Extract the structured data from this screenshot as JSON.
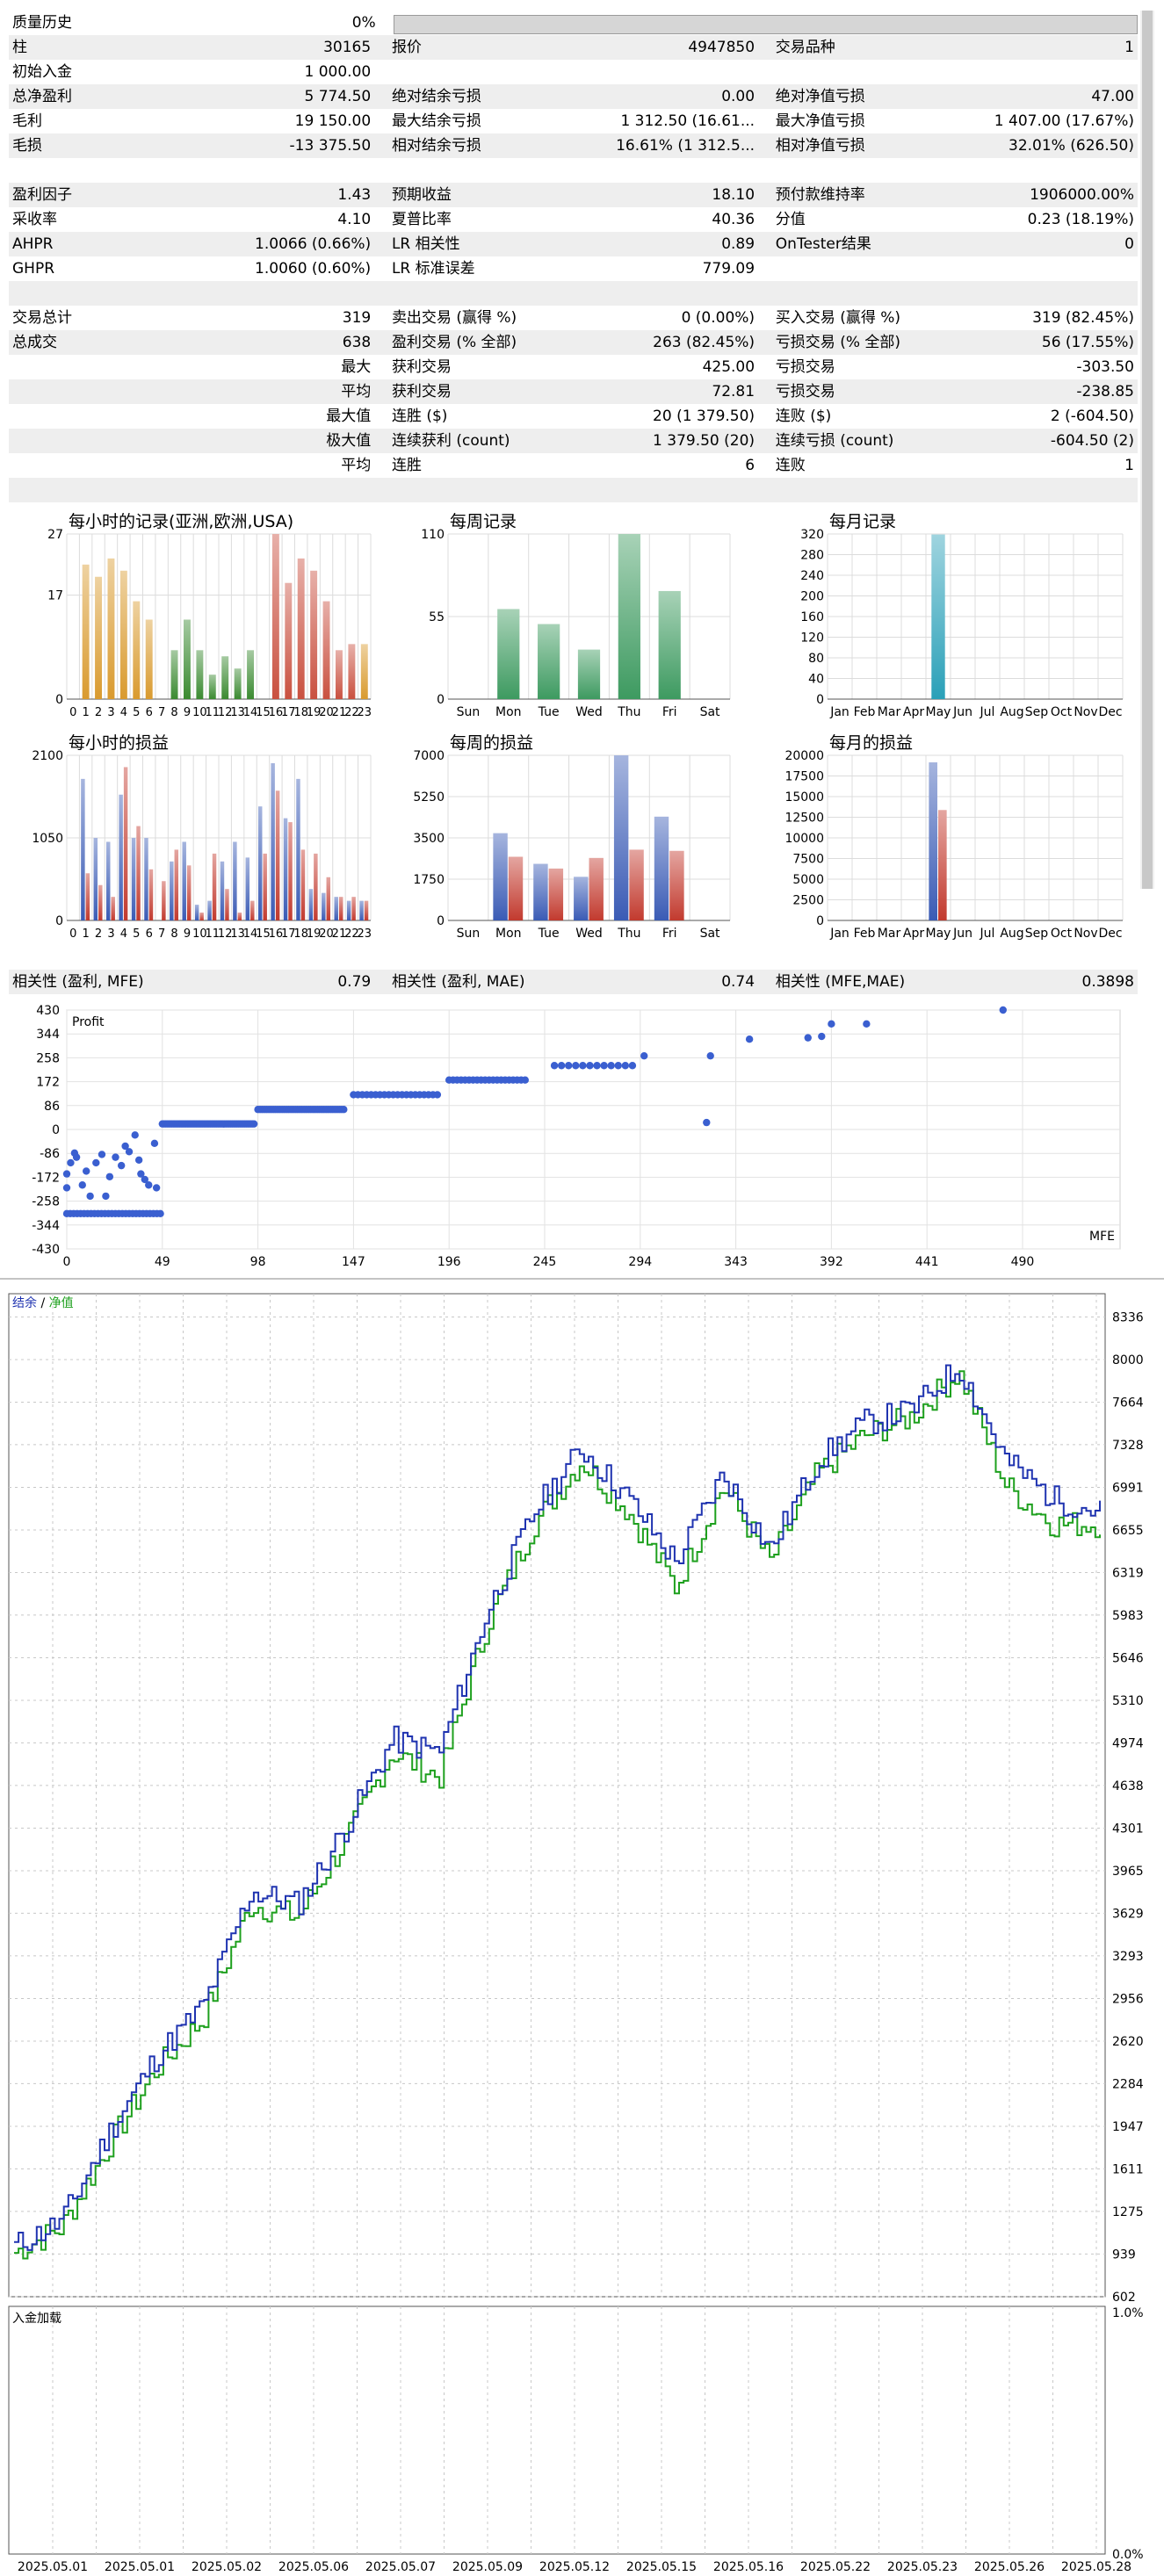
{
  "stats": {
    "rows": [
      {
        "k1": "质量历史",
        "v1": "0%",
        "qbar": true
      },
      {
        "k1": "柱",
        "v1": "30165",
        "k2": "报价",
        "v2": "4947850",
        "k3": "交易品种",
        "v3": "1"
      },
      {
        "k1": "初始入金",
        "v1": "1 000.00"
      },
      {
        "k1": "总净盈利",
        "v1": "5 774.50",
        "k2": "绝对结余亏损",
        "v2": "0.00",
        "k3": "绝对净值亏损",
        "v3": "47.00"
      },
      {
        "k1": "毛利",
        "v1": "19 150.00",
        "k2": "最大结余亏损",
        "v2": "1 312.50 (16.61...",
        "k3": "最大净值亏损",
        "v3": "1 407.00 (17.67%)"
      },
      {
        "k1": "毛损",
        "v1": "-13 375.50",
        "k2": "相对结余亏损",
        "v2": "16.61% (1 312.5...",
        "k3": "相对净值亏损",
        "v3": "32.01% (626.50)"
      },
      {
        "blank": true
      },
      {
        "k1": "盈利因子",
        "v1": "1.43",
        "k2": "预期收益",
        "v2": "18.10",
        "k3": "预付款维持率",
        "v3": "1906000.00%"
      },
      {
        "k1": "采收率",
        "v1": "4.10",
        "k2": "夏普比率",
        "v2": "40.36",
        "k3": "分值",
        "v3": "0.23 (18.19%)"
      },
      {
        "k1": "AHPR",
        "v1": "1.0066 (0.66%)",
        "k2": "LR 相关性",
        "v2": "0.89",
        "k3": "OnTester结果",
        "v3": "0"
      },
      {
        "k1": "GHPR",
        "v1": "1.0060 (0.60%)",
        "k2": "LR 标准误差",
        "v2": "779.09"
      },
      {
        "blank": true
      },
      {
        "k1": "交易总计",
        "v1": "319",
        "k2": "卖出交易 (赢得 %)",
        "v2": "0 (0.00%)",
        "k3": "买入交易 (赢得 %)",
        "v3": "319 (82.45%)"
      },
      {
        "k1": "总成交",
        "v1": "638",
        "k2": "盈利交易 (% 全部)",
        "v2": "263 (82.45%)",
        "k3": "亏损交易 (% 全部)",
        "v3": "56 (17.55%)"
      },
      {
        "v1": "最大",
        "k2": "获利交易",
        "v2": "425.00",
        "k3": "亏损交易",
        "v3": "-303.50"
      },
      {
        "v1": "平均",
        "k2": "获利交易",
        "v2": "72.81",
        "k3": "亏损交易",
        "v3": "-238.85"
      },
      {
        "v1": "最大值",
        "k2": "连胜 ($)",
        "v2": "20 (1 379.50)",
        "k3": "连败 ($)",
        "v3": "2 (-604.50)"
      },
      {
        "v1": "极大值",
        "k2": "连续获利 (count)",
        "v2": "1 379.50 (20)",
        "k3": "连续亏损 (count)",
        "v3": "-604.50 (2)"
      },
      {
        "v1": "平均",
        "k2": "连胜",
        "v2": "6",
        "k3": "连败",
        "v3": "1"
      },
      {
        "blank": true
      }
    ],
    "corr": [
      {
        "k1": "相关性 (盈利, MFE)",
        "v1": "0.79",
        "k2": "相关性 (盈利, MAE)",
        "v2": "0.74",
        "k3": "相关性 (MFE,MAE)",
        "v3": "0.3898"
      }
    ]
  },
  "chart_data": [
    {
      "id": "hourly-records",
      "type": "bar",
      "title": "每小时的记录(亚洲,欧洲,USA)",
      "categories": [
        "0",
        "1",
        "2",
        "3",
        "4",
        "5",
        "6",
        "7",
        "8",
        "9",
        "10",
        "11",
        "12",
        "13",
        "14",
        "15",
        "16",
        "17",
        "18",
        "19",
        "20",
        "21",
        "22",
        "23"
      ],
      "values": [
        0,
        22,
        20,
        23,
        21,
        16,
        13,
        0,
        8,
        13,
        8,
        4,
        7,
        5,
        8,
        0,
        27,
        19,
        23,
        21,
        16,
        8,
        9,
        9
      ],
      "ylim": [
        0,
        27
      ],
      "yticks": [
        0,
        17,
        27
      ],
      "colors": [
        "#d99a2e",
        "#d99a2e",
        "#d99a2e",
        "#d99a2e",
        "#d99a2e",
        "#d99a2e",
        "#d99a2e",
        "#3a8a30",
        "#3a8a30",
        "#3a8a30",
        "#3a8a30",
        "#3a8a30",
        "#3a8a30",
        "#3a8a30",
        "#3a8a30",
        "#c9503f",
        "#c9503f",
        "#c9503f",
        "#c9503f",
        "#c9503f",
        "#c9503f",
        "#c9503f",
        "#c9503f",
        "#d99a2e"
      ]
    },
    {
      "id": "weekly-records",
      "type": "bar",
      "title": "每周记录",
      "categories": [
        "Sun",
        "Mon",
        "Tue",
        "Wed",
        "Thu",
        "Fri",
        "Sat"
      ],
      "values": [
        0,
        60,
        50,
        33,
        110,
        72,
        0
      ],
      "ylim": [
        0,
        110
      ],
      "yticks": [
        0,
        55,
        110
      ],
      "colors": [
        "#3d9a60"
      ]
    },
    {
      "id": "monthly-records",
      "type": "bar",
      "title": "每月记录",
      "categories": [
        "Jan",
        "Feb",
        "Mar",
        "Apr",
        "May",
        "Jun",
        "Jul",
        "Aug",
        "Sep",
        "Oct",
        "Nov",
        "Dec"
      ],
      "values": [
        0,
        0,
        0,
        0,
        319,
        0,
        0,
        0,
        0,
        0,
        0,
        0
      ],
      "ylim": [
        0,
        320
      ],
      "yticks": [
        0,
        40,
        80,
        120,
        160,
        200,
        240,
        280,
        320
      ],
      "colors": [
        "#2aa0b8"
      ]
    },
    {
      "id": "hourly-pl",
      "type": "bar",
      "title": "每小时的损益",
      "categories": [
        "0",
        "1",
        "2",
        "3",
        "4",
        "5",
        "6",
        "7",
        "8",
        "9",
        "10",
        "11",
        "12",
        "13",
        "14",
        "15",
        "16",
        "17",
        "18",
        "19",
        "20",
        "21",
        "22",
        "23"
      ],
      "series": [
        {
          "name": "profit",
          "values": [
            0,
            1800,
            1050,
            1000,
            1600,
            1050,
            1050,
            0,
            750,
            1000,
            200,
            250,
            750,
            1000,
            800,
            1450,
            2000,
            1300,
            1800,
            400,
            350,
            300,
            250,
            250
          ]
        },
        {
          "name": "loss",
          "values": [
            0,
            600,
            450,
            300,
            1950,
            1200,
            650,
            500,
            900,
            700,
            100,
            850,
            400,
            100,
            250,
            850,
            1650,
            1250,
            900,
            850,
            550,
            300,
            300,
            250
          ]
        }
      ],
      "ylim": [
        0,
        2100
      ],
      "yticks": [
        0,
        1050,
        2100
      ],
      "colors": [
        "#3a5bb5",
        "#c23a2e"
      ]
    },
    {
      "id": "weekly-pl",
      "type": "bar",
      "title": "每周的损益",
      "categories": [
        "Sun",
        "Mon",
        "Tue",
        "Wed",
        "Thu",
        "Fri",
        "Sat"
      ],
      "series": [
        {
          "name": "profit",
          "values": [
            0,
            3700,
            2400,
            1850,
            7000,
            4400,
            0
          ]
        },
        {
          "name": "loss",
          "values": [
            0,
            2700,
            2200,
            2650,
            3000,
            2950,
            0
          ]
        }
      ],
      "ylim": [
        0,
        7000
      ],
      "yticks": [
        0,
        1750,
        3500,
        5250,
        7000
      ],
      "colors": [
        "#3a5bb5",
        "#c23a2e"
      ]
    },
    {
      "id": "monthly-pl",
      "type": "bar",
      "title": "每月的损益",
      "categories": [
        "Jan",
        "Feb",
        "Mar",
        "Apr",
        "May",
        "Jun",
        "Jul",
        "Aug",
        "Sep",
        "Oct",
        "Nov",
        "Dec"
      ],
      "series": [
        {
          "name": "profit",
          "values": [
            0,
            0,
            0,
            0,
            19150,
            0,
            0,
            0,
            0,
            0,
            0,
            0
          ]
        },
        {
          "name": "loss",
          "values": [
            0,
            0,
            0,
            0,
            13375,
            0,
            0,
            0,
            0,
            0,
            0,
            0
          ]
        }
      ],
      "ylim": [
        0,
        20000
      ],
      "yticks": [
        0,
        2500,
        5000,
        7500,
        10000,
        12500,
        15000,
        17500,
        20000
      ],
      "colors": [
        "#3a5bb5",
        "#c23a2e"
      ]
    },
    {
      "id": "mfe-scatter",
      "type": "scatter",
      "ylabel": "Profit",
      "xlabel": "MFE",
      "xlim": [
        0,
        540
      ],
      "ylim": [
        -430,
        430
      ],
      "xticks": [
        0,
        49,
        98,
        147,
        196,
        245,
        294,
        343,
        392,
        441,
        490
      ],
      "yticks": [
        430,
        344,
        258,
        172,
        86,
        0,
        -86,
        -172,
        -258,
        -344,
        -430
      ],
      "clusters": [
        {
          "x0": 0,
          "x1": 48,
          "y": -303,
          "n": 28
        },
        {
          "x0": 49,
          "x1": 96,
          "y": 20,
          "n": 60
        },
        {
          "x0": 98,
          "x1": 142,
          "y": 72,
          "n": 40
        },
        {
          "x0": 147,
          "x1": 190,
          "y": 125,
          "n": 20
        },
        {
          "x0": 196,
          "x1": 235,
          "y": 178,
          "n": 20
        },
        {
          "x0": 250,
          "x1": 290,
          "y": 230,
          "n": 12
        }
      ],
      "points": [
        [
          0,
          -210
        ],
        [
          0,
          -160
        ],
        [
          2,
          -120
        ],
        [
          4,
          -85
        ],
        [
          5,
          -100
        ],
        [
          8,
          -200
        ],
        [
          10,
          -150
        ],
        [
          12,
          -240
        ],
        [
          15,
          -120
        ],
        [
          18,
          -90
        ],
        [
          20,
          -240
        ],
        [
          22,
          -170
        ],
        [
          25,
          -100
        ],
        [
          28,
          -130
        ],
        [
          30,
          -60
        ],
        [
          32,
          -80
        ],
        [
          35,
          -20
        ],
        [
          37,
          -110
        ],
        [
          38,
          -160
        ],
        [
          40,
          -180
        ],
        [
          42,
          -200
        ],
        [
          45,
          -50
        ],
        [
          46,
          -210
        ],
        [
          296,
          265
        ],
        [
          330,
          265
        ],
        [
          328,
          25
        ],
        [
          350,
          325
        ],
        [
          380,
          330
        ],
        [
          387,
          335
        ],
        [
          392,
          380
        ],
        [
          410,
          380
        ],
        [
          480,
          430
        ]
      ]
    },
    {
      "id": "balance-equity",
      "type": "line",
      "legend": [
        {
          "label": "结余",
          "color": "#1f33b0"
        },
        {
          "label": "净值",
          "color": "#1ea01e"
        }
      ],
      "x": [
        "2025.05.01",
        "2025.05.01",
        "2025.05.02",
        "2025.05.06",
        "2025.05.07",
        "2025.05.09",
        "2025.05.12",
        "2025.05.15",
        "2025.05.16",
        "2025.05.22",
        "2025.05.23",
        "2025.05.26",
        "2025.05.28"
      ],
      "yticks": [
        602,
        939,
        1275,
        1611,
        1947,
        2284,
        2620,
        2956,
        3293,
        3629,
        3965,
        4301,
        4638,
        4974,
        5310,
        5646,
        5983,
        6319,
        6655,
        6991,
        7328,
        7664,
        8000,
        8336
      ],
      "ylim": [
        602,
        8520
      ],
      "series": [
        {
          "name": "结余",
          "values": [
            1000,
            1200,
            1900,
            2500,
            2900,
            3800,
            3700,
            4300,
            5000,
            4900,
            6000,
            6800,
            7300,
            6900,
            6400,
            7100,
            6500,
            7200,
            7500,
            7600,
            7950,
            7200,
            6900,
            6800
          ]
        },
        {
          "name": "净值",
          "values": [
            950,
            1150,
            1800,
            2400,
            2800,
            3700,
            3600,
            4200,
            4900,
            4700,
            5900,
            6700,
            7200,
            6800,
            6200,
            7000,
            6400,
            7100,
            7400,
            7550,
            7900,
            7000,
            6700,
            6700
          ]
        }
      ]
    },
    {
      "id": "deposit-load",
      "type": "area",
      "title": "入金加载",
      "ylim": [
        0,
        1
      ],
      "ylabels": [
        "1.0%",
        "0.0%"
      ]
    }
  ]
}
